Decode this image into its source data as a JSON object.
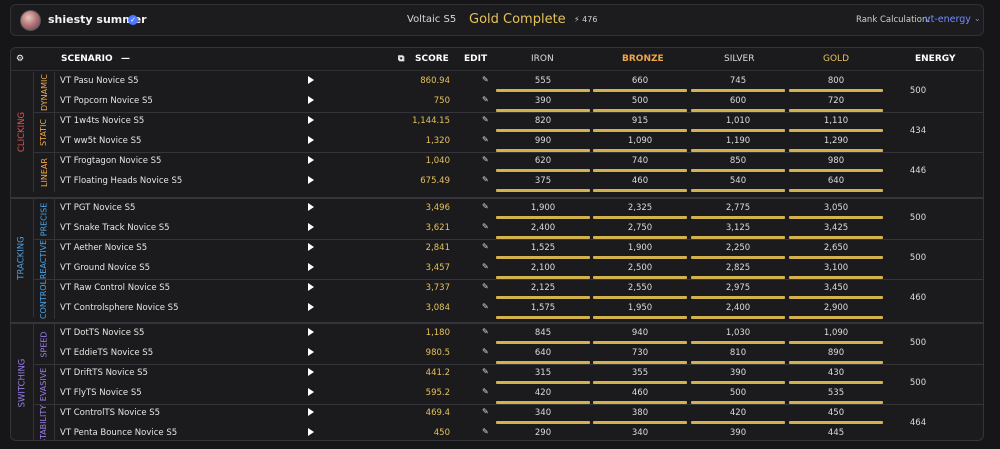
{
  "header": {
    "username": "shiesty summer",
    "season": "Voltaic S5",
    "status": "Gold Complete",
    "energy": "476",
    "rank_label": "Rank Calculation:",
    "rank_value": "vt-energy"
  },
  "columns": {
    "scenario": "SCENARIO",
    "score": "SCORE",
    "edit": "EDIT",
    "iron": "IRON",
    "bronze": "BRONZE",
    "silver": "SILVER",
    "gold": "GOLD",
    "energy": "ENERGY"
  },
  "colors": {
    "clicking": "#e05555",
    "tracking": "#4aa3e8",
    "switching": "#9a7de8",
    "sub_clicking": "#f0a64a",
    "bronze": "#f0a64a",
    "gold": "#e6c15a",
    "accent": "#6e8dff"
  },
  "groups": [
    {
      "label": "CLICKING",
      "subs": [
        {
          "label": "DYNAMIC",
          "energy": "500",
          "rows": [
            {
              "name": "VT Pasu Novice S5",
              "score": "860.94",
              "iron": "555",
              "bronze": "660",
              "silver": "745",
              "gold": "800"
            },
            {
              "name": "VT Popcorn Novice S5",
              "score": "750",
              "iron": "390",
              "bronze": "500",
              "silver": "600",
              "gold": "720"
            }
          ]
        },
        {
          "label": "STATIC",
          "energy": "434",
          "rows": [
            {
              "name": "VT 1w4ts Novice S5",
              "score": "1,144.15",
              "iron": "820",
              "bronze": "915",
              "silver": "1,010",
              "gold": "1,110"
            },
            {
              "name": "VT ww5t Novice S5",
              "score": "1,320",
              "iron": "990",
              "bronze": "1,090",
              "silver": "1,190",
              "gold": "1,290"
            }
          ]
        },
        {
          "label": "LINEAR",
          "energy": "446",
          "rows": [
            {
              "name": "VT Frogtagon Novice S5",
              "score": "1,040",
              "iron": "620",
              "bronze": "740",
              "silver": "850",
              "gold": "980"
            },
            {
              "name": "VT Floating Heads Novice S5",
              "score": "675.49",
              "iron": "375",
              "bronze": "460",
              "silver": "540",
              "gold": "640"
            }
          ]
        }
      ]
    },
    {
      "label": "TRACKING",
      "subs": [
        {
          "label": "PRECISE",
          "energy": "500",
          "rows": [
            {
              "name": "VT PGT Novice S5",
              "score": "3,496",
              "iron": "1,900",
              "bronze": "2,325",
              "silver": "2,775",
              "gold": "3,050"
            },
            {
              "name": "VT Snake Track Novice S5",
              "score": "3,621",
              "iron": "2,400",
              "bronze": "2,750",
              "silver": "3,125",
              "gold": "3,425"
            }
          ]
        },
        {
          "label": "REACTIVE",
          "energy": "500",
          "rows": [
            {
              "name": "VT Aether Novice S5",
              "score": "2,841",
              "iron": "1,525",
              "bronze": "1,900",
              "silver": "2,250",
              "gold": "2,650"
            },
            {
              "name": "VT Ground Novice S5",
              "score": "3,457",
              "iron": "2,100",
              "bronze": "2,500",
              "silver": "2,825",
              "gold": "3,100"
            }
          ]
        },
        {
          "label": "CONTROL",
          "energy": "460",
          "rows": [
            {
              "name": "VT Raw Control Novice S5",
              "score": "3,737",
              "iron": "2,125",
              "bronze": "2,550",
              "silver": "2,975",
              "gold": "3,450"
            },
            {
              "name": "VT Controlsphere Novice S5",
              "score": "3,084",
              "iron": "1,575",
              "bronze": "1,950",
              "silver": "2,400",
              "gold": "2,900"
            }
          ]
        }
      ]
    },
    {
      "label": "SWITCHING",
      "subs": [
        {
          "label": "SPEED",
          "energy": "500",
          "rows": [
            {
              "name": "VT DotTS Novice S5",
              "score": "1,180",
              "iron": "845",
              "bronze": "940",
              "silver": "1,030",
              "gold": "1,090"
            },
            {
              "name": "VT EddieTS Novice S5",
              "score": "980.5",
              "iron": "640",
              "bronze": "730",
              "silver": "810",
              "gold": "890"
            }
          ]
        },
        {
          "label": "EVASIVE",
          "energy": "500",
          "rows": [
            {
              "name": "VT DriftTS Novice S5",
              "score": "441.2",
              "iron": "315",
              "bronze": "355",
              "silver": "390",
              "gold": "430"
            },
            {
              "name": "VT FlyTS Novice S5",
              "score": "595.2",
              "iron": "420",
              "bronze": "460",
              "silver": "500",
              "gold": "535"
            }
          ]
        },
        {
          "label": "STABILITY",
          "energy": "464",
          "rows": [
            {
              "name": "VT ControlTS Novice S5",
              "score": "469.4",
              "iron": "340",
              "bronze": "380",
              "silver": "420",
              "gold": "450"
            },
            {
              "name": "VT Penta Bounce Novice S5",
              "score": "450",
              "iron": "290",
              "bronze": "340",
              "silver": "390",
              "gold": "445"
            }
          ]
        }
      ]
    }
  ]
}
